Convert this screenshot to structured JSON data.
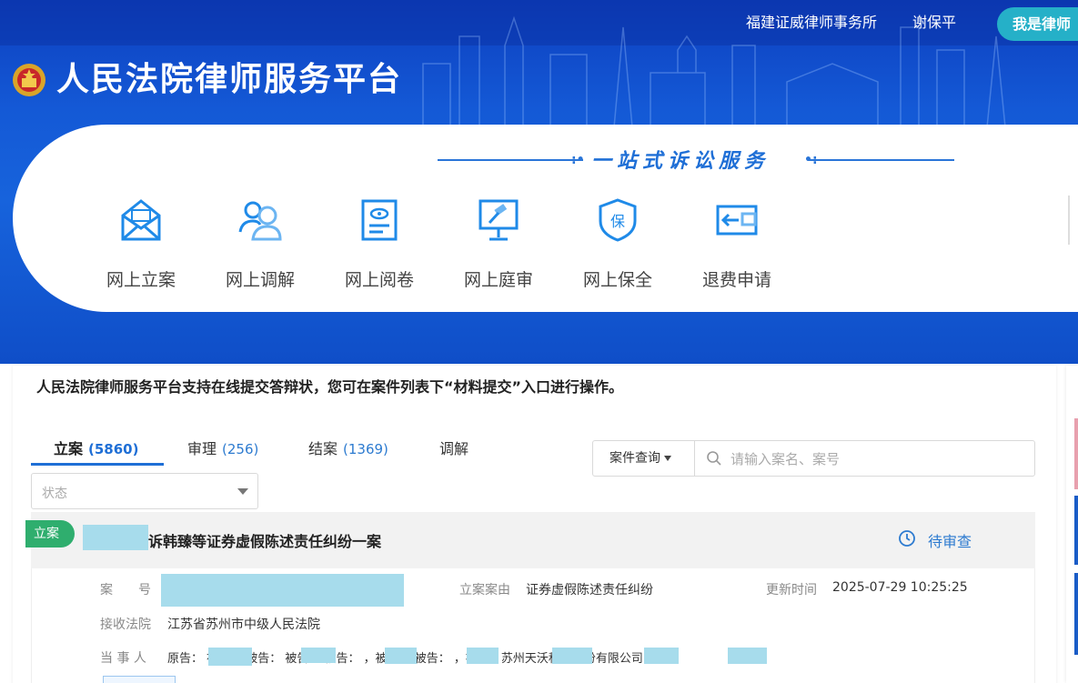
{
  "header": {
    "site_title": "人民法院律师服务平台",
    "user_firm": "福建证威律师事务所",
    "user_name": "谢保平",
    "role_button": "我是律师"
  },
  "services": {
    "slogan": "一站式诉讼服务",
    "items": [
      {
        "label": "网上立案",
        "icon": "envelope-icon"
      },
      {
        "label": "网上调解",
        "icon": "people-icon"
      },
      {
        "label": "网上阅卷",
        "icon": "document-eye-icon"
      },
      {
        "label": "网上庭审",
        "icon": "gavel-screen-icon"
      },
      {
        "label": "网上保全",
        "icon": "shield-bao-icon"
      },
      {
        "label": "退费申请",
        "icon": "refund-wallet-icon"
      }
    ]
  },
  "main": {
    "notice": "人民法院律师服务平台支持在线提交答辩状，您可在案件列表下“材料提交”入口进行操作。",
    "tabs": [
      {
        "label": "立案",
        "count": "(5860)",
        "active": true
      },
      {
        "label": "审理",
        "count": "(256)",
        "active": false
      },
      {
        "label": "结案",
        "count": "(1369)",
        "active": false
      },
      {
        "label": "调解",
        "count": "",
        "active": false
      }
    ],
    "status_placeholder": "状态",
    "search": {
      "type_label": "案件查询",
      "placeholder": "请输入案名、案号"
    }
  },
  "case": {
    "tag": "立案",
    "title": "诉韩臻等证券虚假陈述责任纠纷一案",
    "status": "待审查",
    "fields": {
      "case_no_label": "案　　号",
      "cause_label": "立案案由",
      "cause_value": "证券虚假陈述责任纠纷",
      "updated_label": "更新时间",
      "updated_value": "2025-07-29 10:25:25",
      "court_label": "接收法院",
      "court_value": "江苏省苏州市中级人民法院",
      "party_label": "当 事 人",
      "party_value": "原告：           被告：          被告：         被告：         被告：            ，被告：           被告：             ，被告：苏州天沃科技股份有限公司，被..."
    }
  },
  "colors": {
    "banner_blue": "#1763dc",
    "accent_blue": "#1f6fd6",
    "tag_green": "#2fae6e",
    "role_button": "#25b0c8",
    "redaction": "#a7dcec"
  }
}
